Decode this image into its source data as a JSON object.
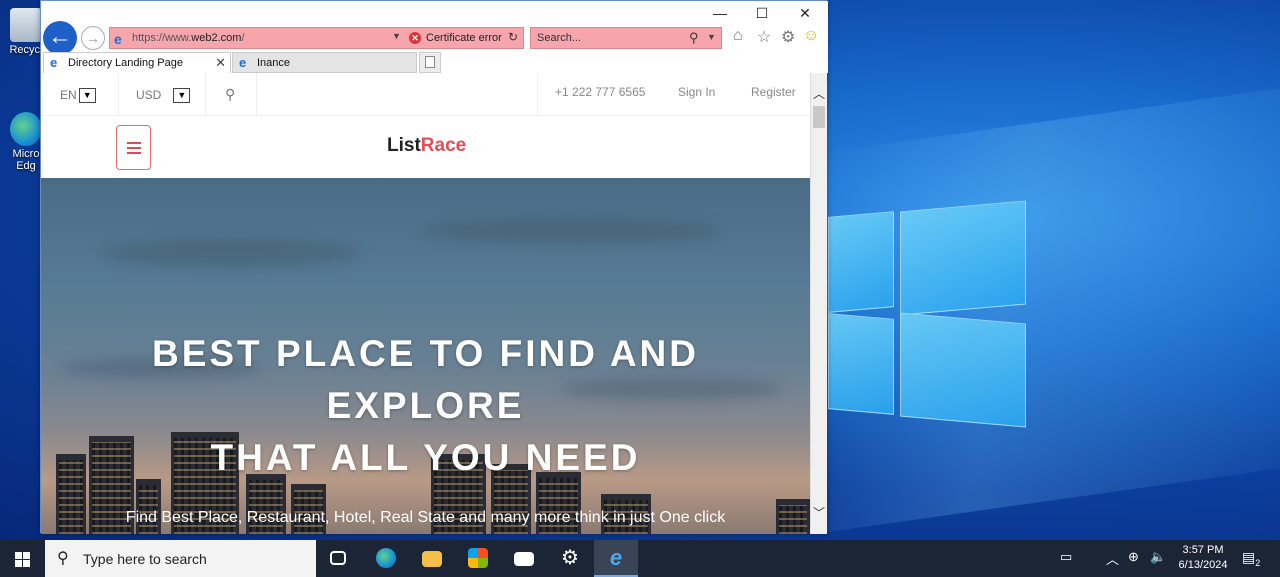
{
  "desktop": {
    "icons": [
      {
        "label": "Recycle Bin",
        "display": "Recycl"
      },
      {
        "label": "Microsoft Edge",
        "display_line1": "Micro",
        "display_line2": "Edg"
      }
    ]
  },
  "browser": {
    "address": {
      "prefix": "https://www.",
      "domain": "web2.com",
      "suffix": "/",
      "cert_label": "Certificate error"
    },
    "search_placeholder": "Search...",
    "tabs": [
      {
        "label": "Directory Landing Page",
        "active": true
      },
      {
        "label": "Inance",
        "active": false
      }
    ],
    "window_buttons": {
      "minimize": "—",
      "maximize": "☐",
      "close": "✕"
    }
  },
  "page": {
    "lang_label": "EN",
    "currency_label": "USD",
    "phone": "+1 222 777 6565",
    "sign_in": "Sign In",
    "register": "Register",
    "logo_part1": "List",
    "logo_part2": "Race",
    "hero_title_line1": "BEST PLACE TO FIND AND",
    "hero_title_line2": "EXPLORE",
    "hero_title_line3": "THAT ALL YOU NEED",
    "hero_subtitle": "Find Best Place, Restaurant, Hotel, Real State and many more think in just One click",
    "accent_color": "#e64c55"
  },
  "taskbar": {
    "search_placeholder": "Type here to search",
    "time": "3:57 PM",
    "date": "6/13/2024",
    "notification_count": "2"
  }
}
